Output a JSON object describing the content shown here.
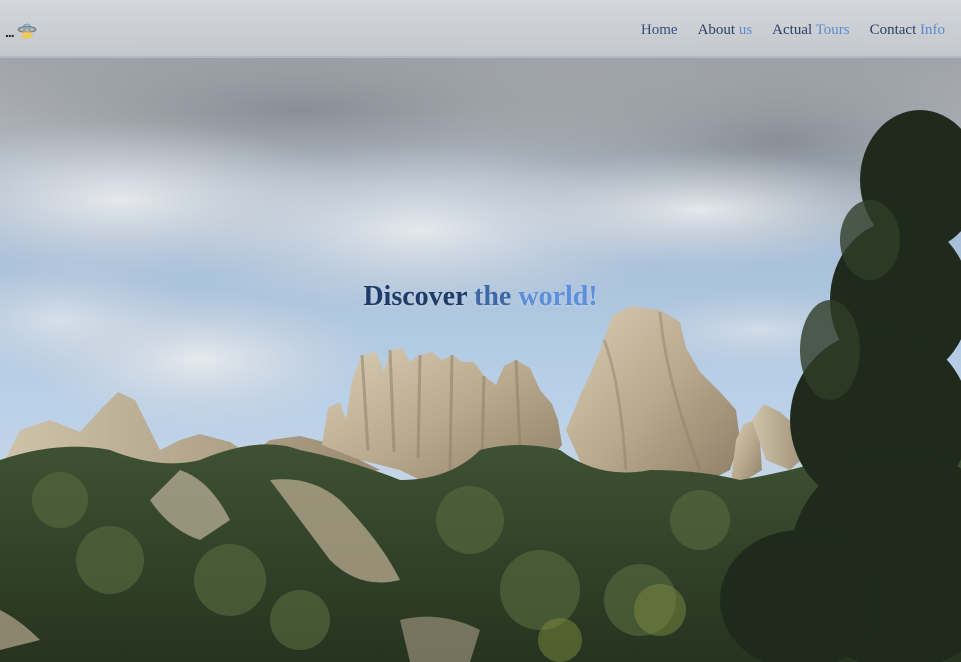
{
  "brand": {
    "dots": "...",
    "logo_icon": "ufo-icon"
  },
  "nav": {
    "items": [
      {
        "id": "home",
        "label": "Home"
      },
      {
        "id": "about",
        "label_part1": "About",
        "label_part2": " us"
      },
      {
        "id": "tours",
        "label_part1": "Actual",
        "label_part2": " Tours"
      },
      {
        "id": "contact",
        "label_part1": "Contact",
        "label_part2": " Info"
      }
    ]
  },
  "hero": {
    "headline_part1": "Discover",
    "headline_part2": " the",
    "headline_part3": " world!",
    "background": "mountain-landscape-photo"
  },
  "colors": {
    "nav_dark": "#2b3f66",
    "nav_accent": "#5b8ad0",
    "headline_dark": "#1f3b68",
    "headline_light": "#5d8fdb"
  }
}
